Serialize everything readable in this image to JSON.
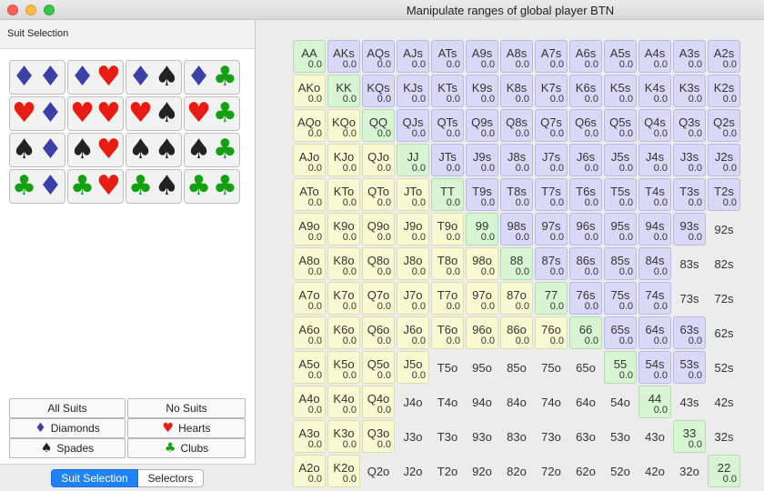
{
  "window": {
    "title": "Manipulate ranges of global player BTN"
  },
  "left_panel": {
    "header": "Suit Selection"
  },
  "suit_combos": [
    [
      "diamond",
      "diamond"
    ],
    [
      "diamond",
      "heart"
    ],
    [
      "diamond",
      "spade"
    ],
    [
      "diamond",
      "club"
    ],
    [
      "heart",
      "diamond"
    ],
    [
      "heart",
      "heart"
    ],
    [
      "heart",
      "spade"
    ],
    [
      "heart",
      "club"
    ],
    [
      "spade",
      "diamond"
    ],
    [
      "spade",
      "heart"
    ],
    [
      "spade",
      "spade"
    ],
    [
      "spade",
      "club"
    ],
    [
      "club",
      "diamond"
    ],
    [
      "club",
      "heart"
    ],
    [
      "club",
      "spade"
    ],
    [
      "club",
      "club"
    ]
  ],
  "suit_glyphs": {
    "diamond": "♦",
    "heart": "♥",
    "spade": "♠",
    "club": "♣"
  },
  "suit_colors": {
    "diamond": "#3b3fa8",
    "heart": "#e81c12",
    "spade": "#222222",
    "club": "#13a012"
  },
  "buttons": {
    "all_suits": "All Suits",
    "no_suits": "No Suits",
    "diamonds": "Diamonds",
    "hearts": "Hearts",
    "spades": "Spades",
    "clubs": "Clubs"
  },
  "tabs": {
    "suit_selection": "Suit Selection",
    "selectors": "Selectors"
  },
  "range_grid": {
    "frequency_label": "0.0",
    "colors": {
      "blue": "#d9d9f7",
      "yellow": "#fafad2",
      "green": "#d8f5d3"
    },
    "rows": [
      [
        "AA",
        "AKs",
        "AQs",
        "AJs",
        "ATs",
        "A9s",
        "A8s",
        "A7s",
        "A6s",
        "A5s",
        "A4s",
        "A3s",
        "A2s"
      ],
      [
        "AKo",
        "KK",
        "KQs",
        "KJs",
        "KTs",
        "K9s",
        "K8s",
        "K7s",
        "K6s",
        "K5s",
        "K4s",
        "K3s",
        "K2s"
      ],
      [
        "AQo",
        "KQo",
        "QQ",
        "QJs",
        "QTs",
        "Q9s",
        "Q8s",
        "Q7s",
        "Q6s",
        "Q5s",
        "Q4s",
        "Q3s",
        "Q2s"
      ],
      [
        "AJo",
        "KJo",
        "QJo",
        "JJ",
        "JTs",
        "J9s",
        "J8s",
        "J7s",
        "J6s",
        "J5s",
        "J4s",
        "J3s",
        "J2s"
      ],
      [
        "ATo",
        "KTo",
        "QTo",
        "JTo",
        "TT",
        "T9s",
        "T8s",
        "T7s",
        "T6s",
        "T5s",
        "T4s",
        "T3s",
        "T2s"
      ],
      [
        "A9o",
        "K9o",
        "Q9o",
        "J9o",
        "T9o",
        "99",
        "98s",
        "97s",
        "96s",
        "95s",
        "94s",
        "93s",
        "92s"
      ],
      [
        "A8o",
        "K8o",
        "Q8o",
        "J8o",
        "T8o",
        "98o",
        "88",
        "87s",
        "86s",
        "85s",
        "84s",
        "83s",
        "82s"
      ],
      [
        "A7o",
        "K7o",
        "Q7o",
        "J7o",
        "T7o",
        "97o",
        "87o",
        "77",
        "76s",
        "75s",
        "74s",
        "73s",
        "72s"
      ],
      [
        "A6o",
        "K6o",
        "Q6o",
        "J6o",
        "T6o",
        "96o",
        "86o",
        "76o",
        "66",
        "65s",
        "64s",
        "63s",
        "62s"
      ],
      [
        "A5o",
        "K5o",
        "Q5o",
        "J5o",
        "T5o",
        "95o",
        "85o",
        "75o",
        "65o",
        "55",
        "54s",
        "53s",
        "52s"
      ],
      [
        "A4o",
        "K4o",
        "Q4o",
        "J4o",
        "T4o",
        "94o",
        "84o",
        "74o",
        "64o",
        "54o",
        "44",
        "43s",
        "42s"
      ],
      [
        "A3o",
        "K3o",
        "Q3o",
        "J3o",
        "T3o",
        "93o",
        "83o",
        "73o",
        "63o",
        "53o",
        "43o",
        "33",
        "32s"
      ],
      [
        "A2o",
        "K2o",
        "Q2o",
        "J2o",
        "T2o",
        "92o",
        "82o",
        "72o",
        "62o",
        "52o",
        "42o",
        "32o",
        "22"
      ]
    ],
    "fill": [
      [
        "G",
        "B",
        "B",
        "B",
        "B",
        "B",
        "B",
        "B",
        "B",
        "B",
        "B",
        "B",
        "B"
      ],
      [
        "Y",
        "G",
        "B",
        "B",
        "B",
        "B",
        "B",
        "B",
        "B",
        "B",
        "B",
        "B",
        "B"
      ],
      [
        "Y",
        "Y",
        "G",
        "B",
        "B",
        "B",
        "B",
        "B",
        "B",
        "B",
        "B",
        "B",
        "B"
      ],
      [
        "Y",
        "Y",
        "Y",
        "G",
        "B",
        "B",
        "B",
        "B",
        "B",
        "B",
        "B",
        "B",
        "B"
      ],
      [
        "Y",
        "Y",
        "Y",
        "Y",
        "G",
        "B",
        "B",
        "B",
        "B",
        "B",
        "B",
        "B",
        "B"
      ],
      [
        "Y",
        "Y",
        "Y",
        "Y",
        "Y",
        "G",
        "B",
        "B",
        "B",
        "B",
        "B",
        "B",
        "-"
      ],
      [
        "Y",
        "Y",
        "Y",
        "Y",
        "Y",
        "Y",
        "G",
        "B",
        "B",
        "B",
        "B",
        "-",
        "-"
      ],
      [
        "Y",
        "Y",
        "Y",
        "Y",
        "Y",
        "Y",
        "Y",
        "G",
        "B",
        "B",
        "B",
        "-",
        "-"
      ],
      [
        "Y",
        "Y",
        "Y",
        "Y",
        "Y",
        "Y",
        "Y",
        "Y",
        "G",
        "B",
        "B",
        "B",
        "-"
      ],
      [
        "Y",
        "Y",
        "Y",
        "Y",
        "-",
        "-",
        "-",
        "-",
        "-",
        "G",
        "B",
        "B",
        "-"
      ],
      [
        "Y",
        "Y",
        "Y",
        "-",
        "-",
        "-",
        "-",
        "-",
        "-",
        "-",
        "G",
        "-",
        "-"
      ],
      [
        "Y",
        "Y",
        "Y",
        "-",
        "-",
        "-",
        "-",
        "-",
        "-",
        "-",
        "-",
        "G",
        "-"
      ],
      [
        "Y",
        "Y",
        "-",
        "-",
        "-",
        "-",
        "-",
        "-",
        "-",
        "-",
        "-",
        "-",
        "G"
      ]
    ]
  }
}
